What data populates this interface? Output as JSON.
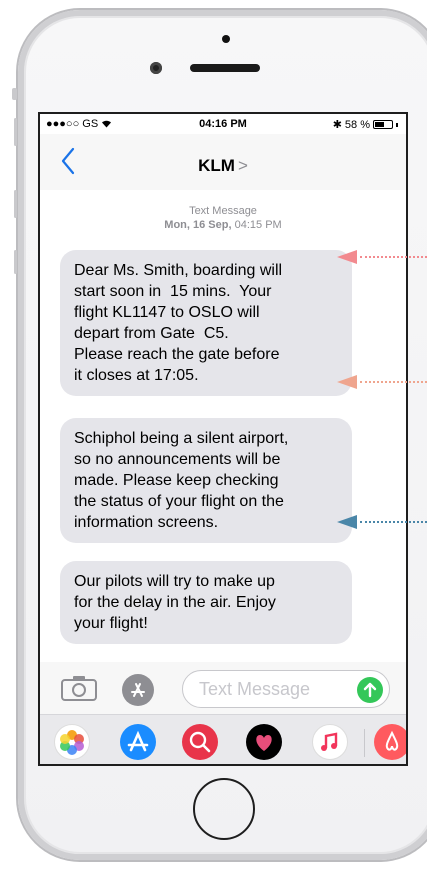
{
  "status_bar": {
    "carrier": "●●●○○ GS",
    "time": "04:16 PM",
    "battery_percent": "58 %",
    "battery_level": 0.58
  },
  "nav": {
    "title": "KLM",
    "title_chevron": ">"
  },
  "thread": {
    "header_type": "Text Message",
    "header_date": "Mon, 16 Sep,",
    "header_time": "04:15 PM"
  },
  "messages": [
    {
      "lines": [
        "Dear Ms. Smith, boarding will",
        "start soon in  15 mins.  Your",
        "flight KL1147 to OSLO will",
        "depart from Gate  C5.",
        "Please reach the gate before",
        "it closes at 17:05."
      ]
    },
    {
      "lines": [
        "Schiphol being a silent airport,",
        "so no announcements will be",
        "made. Please keep checking",
        "the status of your flight on the",
        "information screens."
      ]
    },
    {
      "lines": [
        "Our pilots will try to make up",
        "for the delay in the air. Enjoy",
        "your flight!"
      ]
    }
  ],
  "compose": {
    "placeholder": "Text Message"
  },
  "app_drawer": {
    "apps": [
      "photos-icon",
      "app-store-icon",
      "search-images-icon",
      "digital-touch-icon",
      "music-icon",
      "airbnb-icon"
    ]
  },
  "colors": {
    "bubble": "#e5e5ea",
    "send": "#34c759",
    "annotation_pink": "#f28a8f",
    "annotation_salmon": "#efa58e",
    "annotation_teal": "#4a86a8",
    "nav_chevron": "#1a73e8"
  }
}
